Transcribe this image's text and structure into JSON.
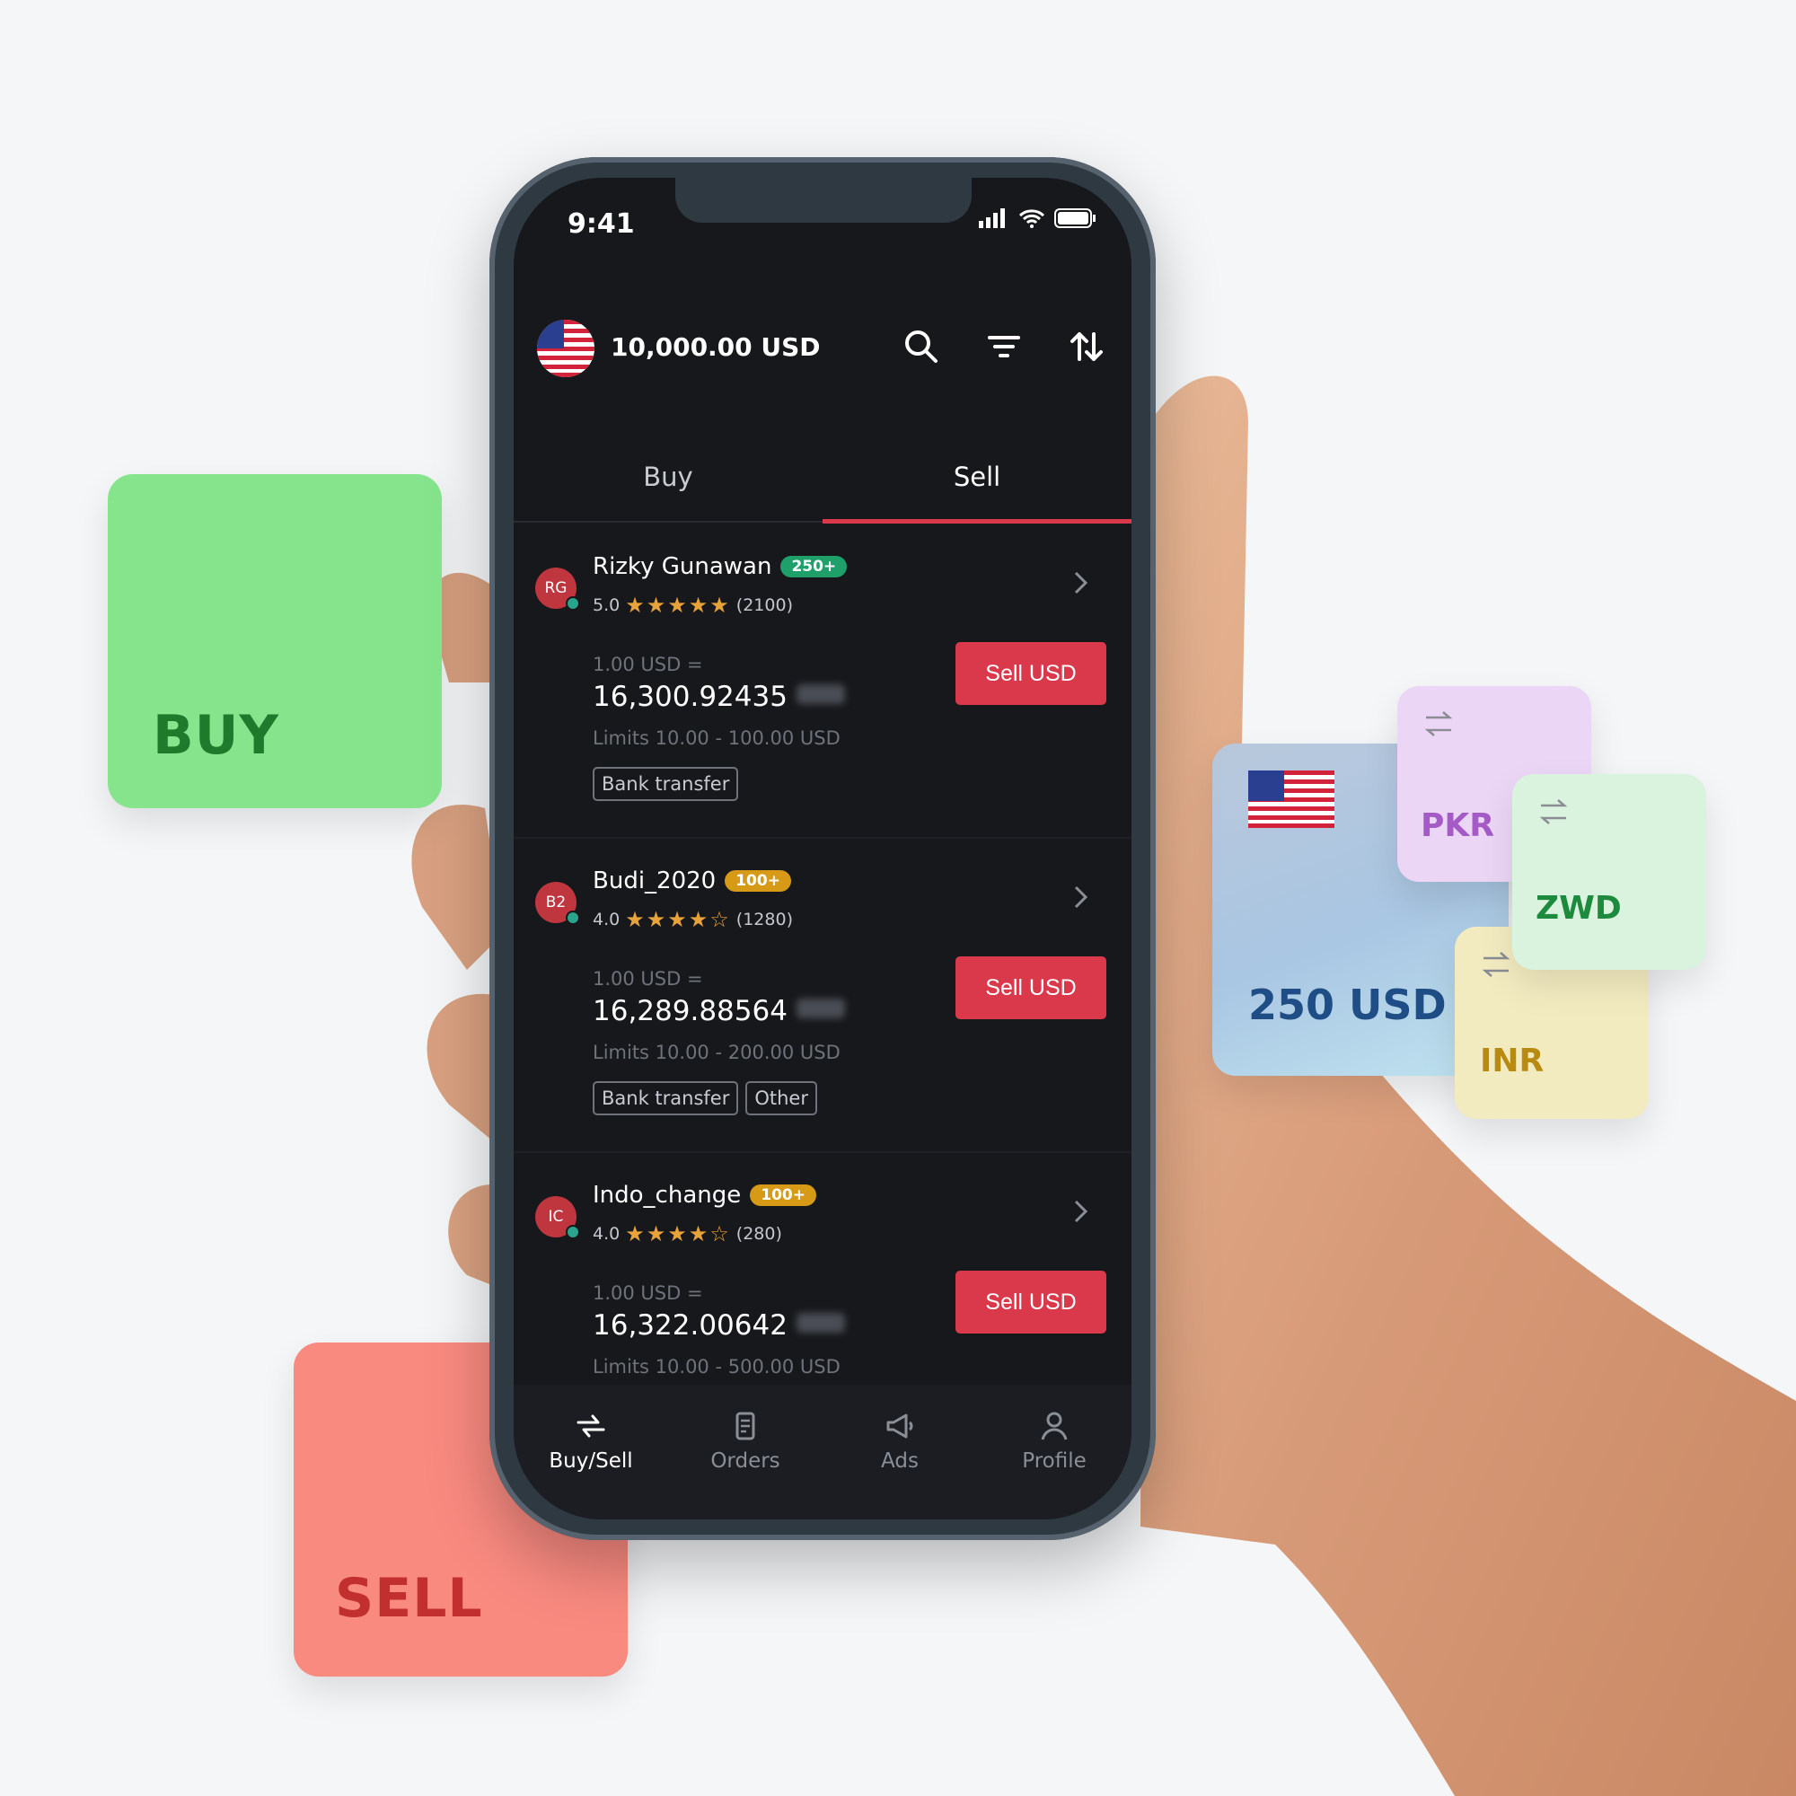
{
  "tiles": {
    "buy_label": "BUY",
    "sell_label": "SELL",
    "amount_label": "250 USD",
    "currencies": [
      "PKR",
      "ZWD",
      "INR"
    ]
  },
  "status_bar": {
    "time": "9:41"
  },
  "header": {
    "balance": "10,000.00 USD",
    "icons": [
      "search-icon",
      "filter-icon",
      "sort-icon"
    ]
  },
  "tabs": [
    {
      "label": "Buy",
      "active": false
    },
    {
      "label": "Sell",
      "active": true
    }
  ],
  "offers": [
    {
      "initials": "RG",
      "name": "Rizky Gunawan",
      "badge": "250+",
      "badge_color": "#1fa06b",
      "rating": "5.0",
      "stars": "★★★★★",
      "reviews": "(2100)",
      "rate_label": "1.00 USD =",
      "rate_value": "16,300.92435",
      "limits": "Limits 10.00 - 100.00 USD",
      "methods": [
        "Bank transfer"
      ],
      "button": "Sell USD"
    },
    {
      "initials": "B2",
      "name": "Budi_2020",
      "badge": "100+",
      "badge_color": "#d79a16",
      "rating": "4.0",
      "stars": "★★★★☆",
      "reviews": "(1280)",
      "rate_label": "1.00 USD =",
      "rate_value": "16,289.88564",
      "limits": "Limits 10.00 - 200.00 USD",
      "methods": [
        "Bank transfer",
        "Other"
      ],
      "button": "Sell USD"
    },
    {
      "initials": "IC",
      "name": "Indo_change",
      "badge": "100+",
      "badge_color": "#d79a16",
      "rating": "4.0",
      "stars": "★★★★☆",
      "reviews": "(280)",
      "rate_label": "1.00 USD =",
      "rate_value": "16,322.00642",
      "limits": "Limits 10.00 - 500.00 USD",
      "methods": [],
      "button": "Sell USD"
    }
  ],
  "bottom_nav": [
    {
      "label": "Buy/Sell",
      "icon": "swap-arrows-icon",
      "active": true
    },
    {
      "label": "Orders",
      "icon": "document-icon",
      "active": false
    },
    {
      "label": "Ads",
      "icon": "megaphone-icon",
      "active": false
    },
    {
      "label": "Profile",
      "icon": "user-icon",
      "active": false
    }
  ],
  "colors": {
    "accent_red": "#d9394a",
    "screen_bg": "#17181c",
    "star": "#e7a23a",
    "online_dot": "#2aa48c"
  }
}
